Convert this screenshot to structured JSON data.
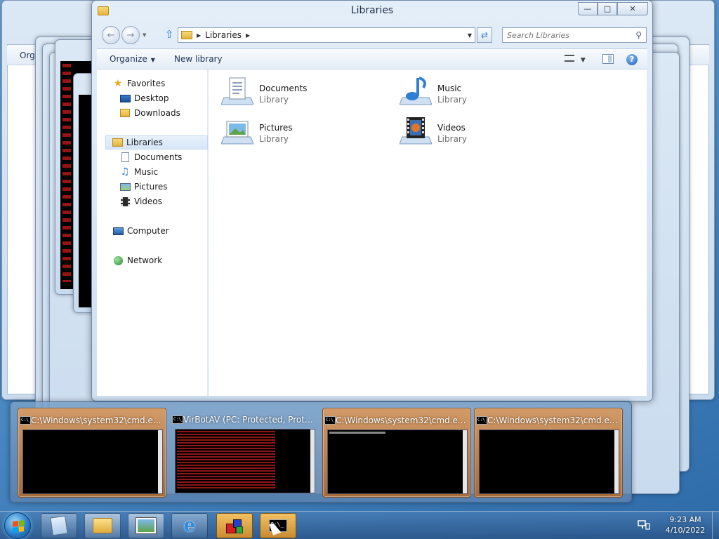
{
  "main_window": {
    "title": "Libraries",
    "address": {
      "crumb": "Libraries",
      "search_placeholder": "Search Libraries"
    },
    "command_bar": {
      "organize": "Organize",
      "new_library": "New library"
    },
    "nav": {
      "favorites": "Favorites",
      "favorites_items": [
        "Desktop",
        "Downloads"
      ],
      "libraries": "Libraries",
      "libraries_items": [
        "Documents",
        "Music",
        "Pictures",
        "Videos"
      ],
      "computer": "Computer",
      "network": "Network"
    },
    "libraries": [
      {
        "name": "Documents",
        "type": "Library",
        "icon": "documents-library-icon"
      },
      {
        "name": "Music",
        "type": "Library",
        "icon": "music-library-icon"
      },
      {
        "name": "Pictures",
        "type": "Library",
        "icon": "pictures-library-icon"
      },
      {
        "name": "Videos",
        "type": "Library",
        "icon": "videos-library-icon"
      }
    ]
  },
  "background_windows": {
    "organize_label": "Orga"
  },
  "thumbnails": [
    {
      "title": "C:\\Windows\\system32\\cmd.exe...",
      "highlighted": true,
      "content": "black"
    },
    {
      "title": "VirBotAV (PC: Protected, Protec...",
      "highlighted": false,
      "content": "red-text"
    },
    {
      "title": "C:\\Windows\\system32\\cmd.exe...",
      "highlighted": true,
      "content": "text"
    },
    {
      "title": "C:\\Windows\\system32\\cmd.exe...",
      "highlighted": true,
      "content": "black"
    }
  ],
  "taskbar": {
    "buttons": [
      "notepad-icon",
      "explorer-icon",
      "photo-viewer-icon",
      "internet-explorer-icon",
      "virbot-icon",
      "cmd-icon"
    ],
    "clock": {
      "time": "9:23 AM",
      "date": "4/10/2022"
    }
  },
  "colors": {
    "thumb_highlight": "#c98a54",
    "taskbar_active": "#e3a94a",
    "accent_blue": "#2f7fd4"
  }
}
